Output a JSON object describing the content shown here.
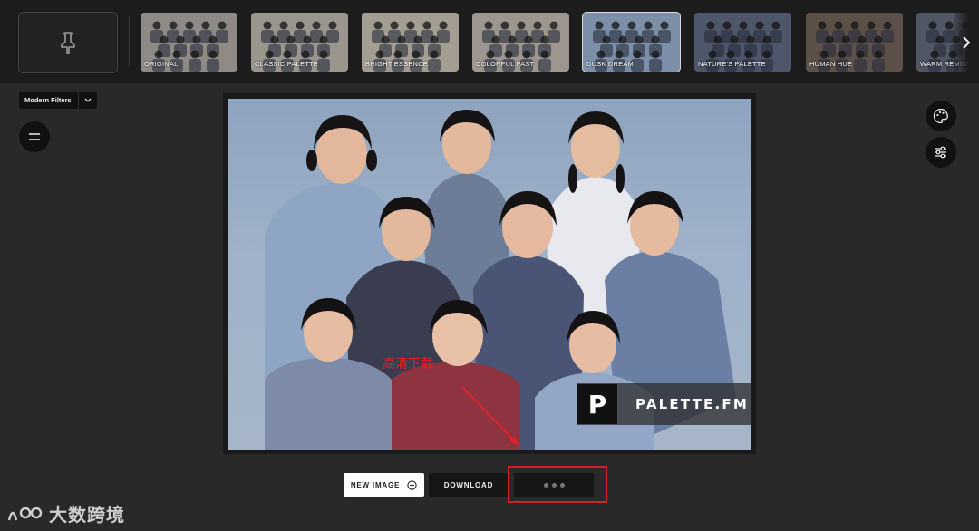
{
  "filters": [
    {
      "label": "ORIGINAL",
      "tint": "#8f8a85",
      "active": false
    },
    {
      "label": "CLASSIC PALETTE",
      "tint": "#9a958d",
      "active": false
    },
    {
      "label": "BRIGHT ESSENCE",
      "tint": "#a49d92",
      "active": false
    },
    {
      "label": "COLORFUL PAST",
      "tint": "#9c968e",
      "active": false
    },
    {
      "label": "DUSK DREAM",
      "tint": "#7d8fa8",
      "active": true
    },
    {
      "label": "NATURE'S PALETTE",
      "tint": "#4d566a",
      "active": false
    },
    {
      "label": "HUMAN HUE",
      "tint": "#5c5049",
      "active": false
    },
    {
      "label": "WARM REMINISCENCE",
      "tint": "#505663",
      "active": false
    }
  ],
  "filter_menu": {
    "label": "Modern Filters"
  },
  "icons": {
    "pin": "pin-icon",
    "next": "chevron-right-icon",
    "menu": "menu-icon",
    "palette": "palette-icon",
    "adjust": "sliders-icon",
    "add": "plus-circle-icon"
  },
  "photo": {
    "watermark_letter": "P",
    "watermark_text": "PALETTE.FM",
    "annotation": "高清下载"
  },
  "actions": {
    "new_image": "NEW IMAGE",
    "download": "DOWNLOAD"
  },
  "brand": {
    "name": "大数跨境"
  },
  "colors": {
    "background": "#2a2929",
    "topbar": "#1d1c1c",
    "highlight": "#d0202a"
  }
}
